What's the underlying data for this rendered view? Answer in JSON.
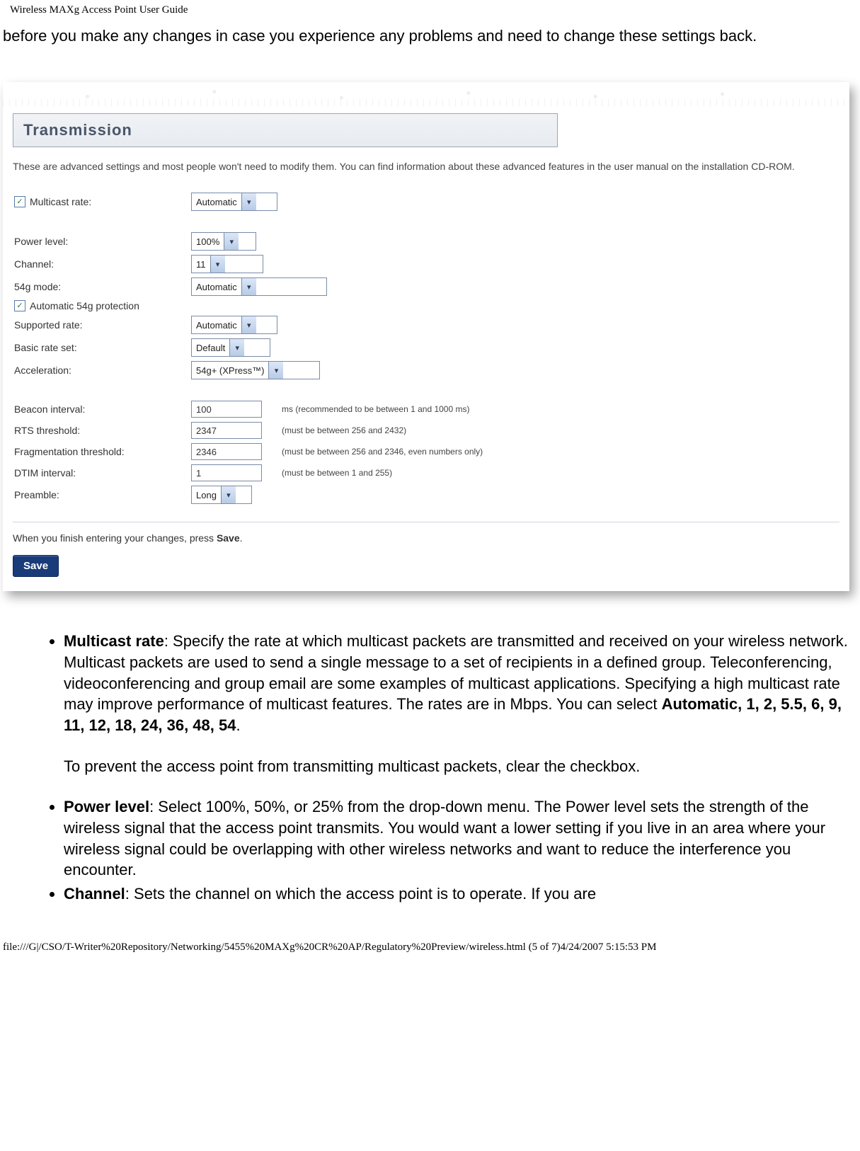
{
  "page_header": "Wireless MAXg Access Point User Guide",
  "intro": "before you make any changes in case you experience any problems and need to change these settings back.",
  "panel": {
    "section_title": "Transmission",
    "help_text": "These are advanced settings and most people won't need to modify them. You can find information about these advanced features in the user manual on the installation CD-ROM.",
    "multicast_rate": {
      "label": "Multicast rate:",
      "value": "Automatic",
      "checked": "✓"
    },
    "power_level": {
      "label": "Power level:",
      "value": "100%"
    },
    "channel": {
      "label": "Channel:",
      "value": "11"
    },
    "mode_54g": {
      "label": "54g mode:",
      "value": "Automatic"
    },
    "auto_54g_protection": {
      "label": "Automatic 54g protection",
      "checked": "✓"
    },
    "supported_rate": {
      "label": "Supported rate:",
      "value": "Automatic"
    },
    "basic_rate_set": {
      "label": "Basic rate set:",
      "value": "Default"
    },
    "acceleration": {
      "label": "Acceleration:",
      "value": "54g+ (XPress™)"
    },
    "beacon_interval": {
      "label": "Beacon interval:",
      "value": "100",
      "hint": "ms (recommended to be between 1 and 1000 ms)"
    },
    "rts_threshold": {
      "label": "RTS threshold:",
      "value": "2347",
      "hint": "(must be between 256 and 2432)"
    },
    "frag_threshold": {
      "label": "Fragmentation threshold:",
      "value": "2346",
      "hint": "(must be between 256 and 2346, even numbers only)"
    },
    "dtim_interval": {
      "label": "DTIM interval:",
      "value": "1",
      "hint": "(must be between 1 and 255)"
    },
    "preamble": {
      "label": "Preamble:",
      "value": "Long"
    },
    "finish_prefix": "When you finish entering your changes, press ",
    "finish_bold": "Save",
    "finish_suffix": ".",
    "save_btn": "Save"
  },
  "list": {
    "multicast": {
      "title": "Multicast rate",
      "body": ": Specify the rate at which multicast packets are transmitted and received on your wireless network. Multicast packets are used to send a single message to a set of recipients in a defined group. Teleconferencing, videoconferencing and group email are some examples of multicast applications. Specifying a high multicast rate may improve performance of multicast features. The rates are in Mbps. You can select ",
      "vals_prefix": "Automatic",
      "vals_rest": ", 1, 2, 5.5, 6, 9, 11, 12, 18, 24, 36, 48, 54",
      "period": ".",
      "extra": "To prevent the access point from transmitting multicast packets, clear the checkbox."
    },
    "power": {
      "title": "Power level",
      "body": ": Select 100%, 50%, or 25% from the drop-down menu. The Power level sets the strength of the wireless signal that the access point transmits. You would want a lower setting if you live in an area where your wireless signal could be overlapping with other wireless networks and want to reduce the interference you encounter."
    },
    "channel": {
      "title": "Channel",
      "body": ": Sets the channel on which the access point is to operate. If you are"
    }
  },
  "footer_path": "file:///G|/CSO/T-Writer%20Repository/Networking/5455%20MAXg%20CR%20AP/Regulatory%20Preview/wireless.html (5 of 7)4/24/2007 5:15:53 PM"
}
